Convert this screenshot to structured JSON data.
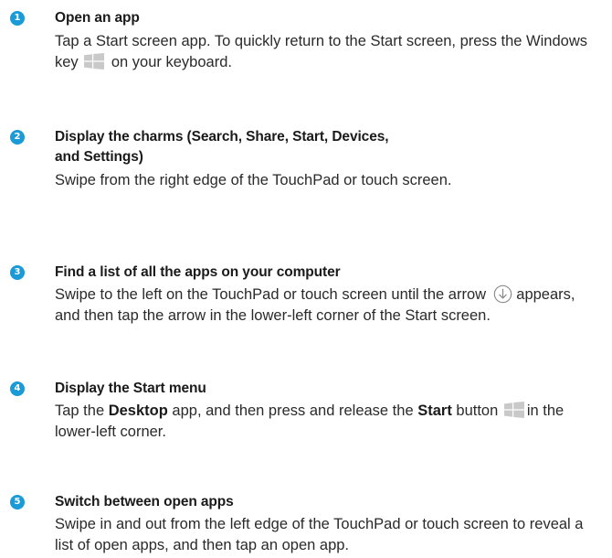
{
  "colors": {
    "badge": "#1a9ad6",
    "icon_gray": "#c9c9c9",
    "text": "#2a2a2a"
  },
  "steps": [
    {
      "number": "1",
      "title": "Open an app",
      "text_a": "Tap a Start screen app. To quickly return to the Start screen, press the Windows key",
      "icon": "windows-logo-icon",
      "text_b": "on your keyboard."
    },
    {
      "number": "2",
      "title_line1": "Display the charms (Search, Share, Start, Devices,",
      "title_line2": "and Settings)",
      "text": "Swipe from the right edge of the TouchPad or touch screen."
    },
    {
      "number": "3",
      "title": "Find a list of all the apps on your computer",
      "text_a": "Swipe to the left on the TouchPad or touch screen until the arrow",
      "icon": "down-arrow-circle-icon",
      "text_b": "appears, and then tap the arrow in the lower-left corner of the Start screen."
    },
    {
      "number": "4",
      "title": "Display the Start menu",
      "text_a": "Tap the",
      "bold_a": "Desktop",
      "text_b": "app, and then press and release the",
      "bold_b": "Start",
      "text_c": "button",
      "icon": "windows-logo-icon",
      "text_d": "in the lower-left corner."
    },
    {
      "number": "5",
      "title": "Switch between open apps",
      "text": "Swipe in and out from the left edge of the TouchPad or touch screen to reveal a list of open apps, and then tap an open app."
    }
  ]
}
